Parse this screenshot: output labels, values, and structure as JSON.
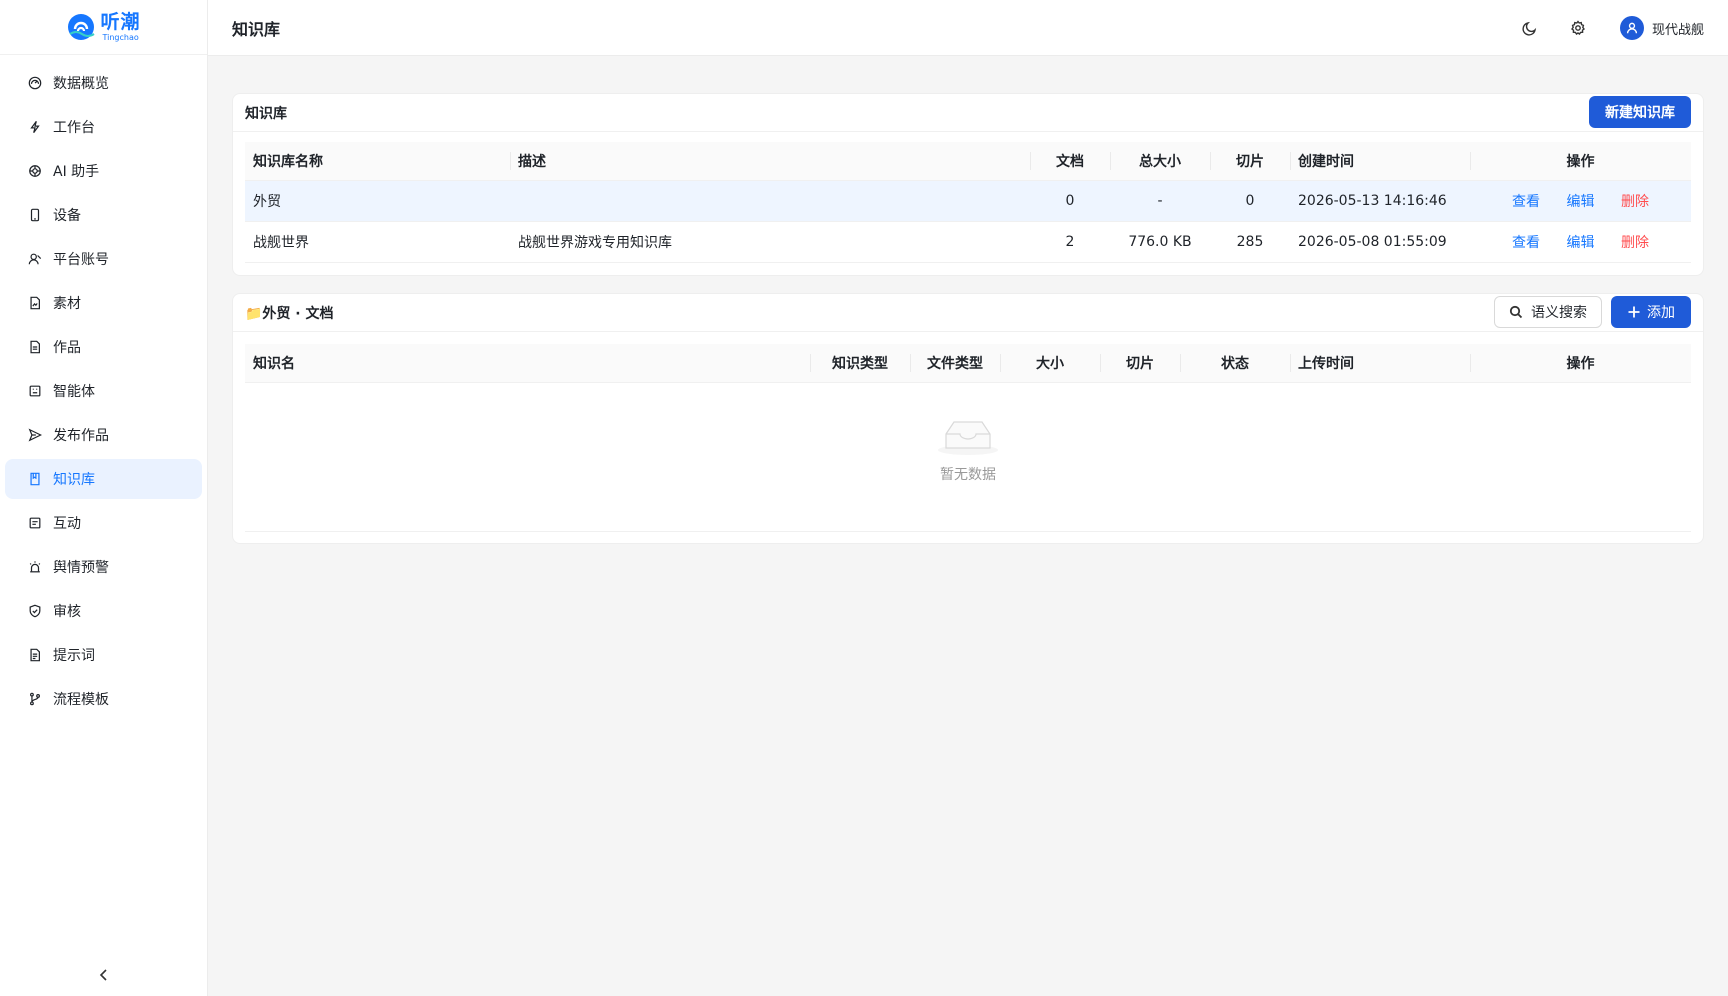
{
  "brand": {
    "name_cn": "听潮",
    "name_en": "Tingchao",
    "color": "#1677ff"
  },
  "sidebar": {
    "items": [
      {
        "label": "数据概览",
        "icon": "dashboard-icon"
      },
      {
        "label": "工作台",
        "icon": "lightning-icon"
      },
      {
        "label": "AI 助手",
        "icon": "ai-icon"
      },
      {
        "label": "设备",
        "icon": "phone-icon"
      },
      {
        "label": "平台账号",
        "icon": "user-account-icon"
      },
      {
        "label": "素材",
        "icon": "file-image-icon"
      },
      {
        "label": "作品",
        "icon": "file-text-icon"
      },
      {
        "label": "智能体",
        "icon": "robot-icon"
      },
      {
        "label": "发布作品",
        "icon": "send-icon"
      },
      {
        "label": "知识库",
        "icon": "book-icon",
        "active": true
      },
      {
        "label": "互动",
        "icon": "message-icon"
      },
      {
        "label": "舆情预警",
        "icon": "alarm-icon"
      },
      {
        "label": "审核",
        "icon": "shield-check-icon"
      },
      {
        "label": "提示词",
        "icon": "file-prompt-icon"
      },
      {
        "label": "流程模板",
        "icon": "git-branch-icon"
      }
    ]
  },
  "header": {
    "title": "知识库",
    "user_name": "现代战舰"
  },
  "kb_card": {
    "title": "知识库",
    "new_button": "新建知识库",
    "columns": [
      "知识库名称",
      "描述",
      "文档",
      "总大小",
      "切片",
      "创建时间",
      "操作"
    ],
    "rows": [
      {
        "name": "外贸",
        "desc": "",
        "docs": "0",
        "size": "-",
        "chunks": "0",
        "created": "2026-05-13 14:16:46"
      },
      {
        "name": "战舰世界",
        "desc": "战舰世界游戏专用知识库",
        "docs": "2",
        "size": "776.0 KB",
        "chunks": "285",
        "created": "2026-05-08 01:55:09"
      }
    ],
    "actions": {
      "view": "查看",
      "edit": "编辑",
      "delete": "删除"
    }
  },
  "doc_card": {
    "title": "📁外贸 · 文档",
    "search_button": "语义搜索",
    "add_button": "添加",
    "columns": [
      "知识名",
      "知识类型",
      "文件类型",
      "大小",
      "切片",
      "状态",
      "上传时间",
      "操作"
    ],
    "empty_text": "暂无数据"
  }
}
